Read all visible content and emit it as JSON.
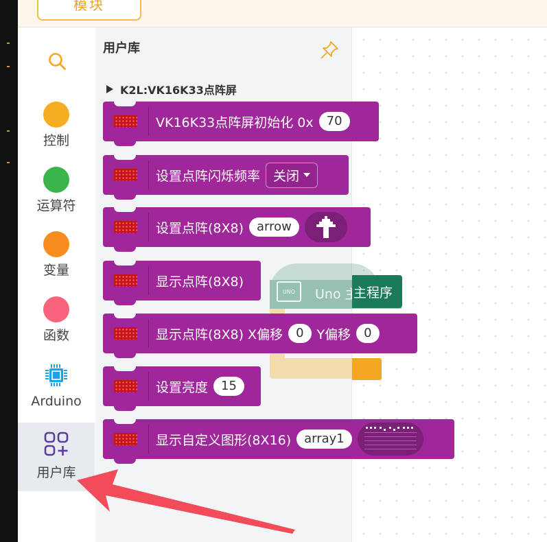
{
  "top": {
    "module_tab": "模块"
  },
  "categories": [
    {
      "label": "控制",
      "color": "#f5ad21"
    },
    {
      "label": "运算符",
      "color": "#3bb44a"
    },
    {
      "label": "变量",
      "color": "#f78d1e"
    },
    {
      "label": "函数",
      "color": "#f8637d"
    },
    {
      "label": "Arduino",
      "icon": "chip-icon",
      "color": "#1aa3e8"
    },
    {
      "label": "用户库",
      "icon": "user-library-icon",
      "color": "#5b3e9e"
    }
  ],
  "flyout": {
    "title": "用户库",
    "section": "K2L:VK16K33点阵屏",
    "blocks": [
      {
        "text": "VK16K33点阵屏初始化 0x",
        "value": "70"
      },
      {
        "text": "设置点阵闪烁频率",
        "dropdown": "关闭"
      },
      {
        "text": "设置点阵(8X8)",
        "value": "arrow"
      },
      {
        "text": "显示点阵(8X8)"
      },
      {
        "text": "显示点阵(8X8) X偏移",
        "value": "0",
        "text2": "Y偏移",
        "value2": "0"
      },
      {
        "text": "设置亮度",
        "value": "15"
      },
      {
        "text": "显示自定义图形(8X16)",
        "value": "array1"
      }
    ]
  },
  "workspace": {
    "program_block": "Uno 主程序",
    "program_color": "#1b7a5a",
    "board_label": "UNO"
  },
  "colors": {
    "block": "#a0279a",
    "accent": "#f5b945",
    "annotation_arrow": "#f24b5a"
  }
}
